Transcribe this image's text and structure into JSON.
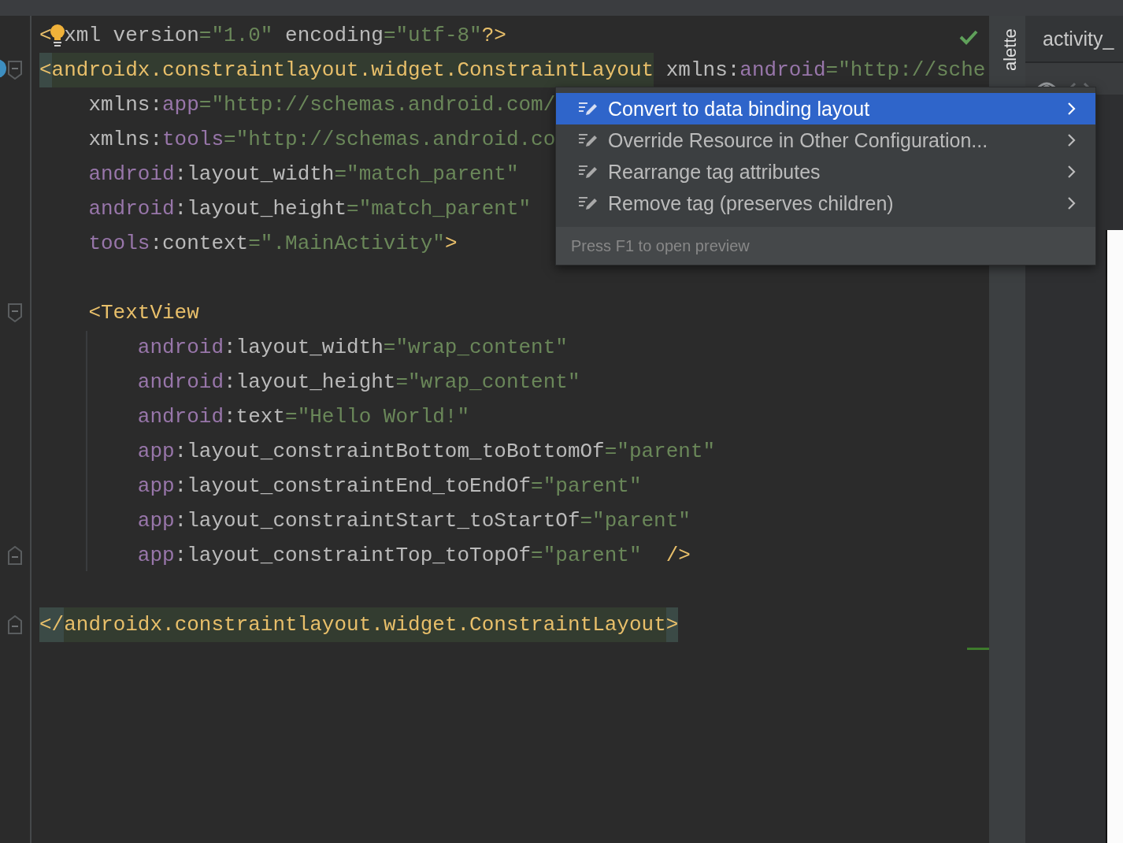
{
  "editor": {
    "lines": [
      {
        "kind": "code",
        "tokens": [
          {
            "t": "<",
            "kind": "tag"
          },
          {
            "kind": "bulb"
          },
          {
            "t": "xml version",
            "kind": "plain"
          },
          {
            "t": "=\"1.0\"",
            "kind": "value"
          },
          {
            "t": " encoding",
            "kind": "plain"
          },
          {
            "t": "=\"utf-8\"",
            "kind": "value"
          },
          {
            "t": "?>",
            "kind": "tag"
          }
        ]
      },
      {
        "kind": "code",
        "marker": {
          "kind": "fold-start"
        },
        "tokens": [
          {
            "t": "<",
            "kind": "bracem"
          },
          {
            "t": "androidx.constraintlayout.widget.ConstraintLayout",
            "kind": "tagm"
          },
          {
            "t": " xmlns:",
            "kind": "plain"
          },
          {
            "t": "android",
            "kind": "ns"
          },
          {
            "t": "=\"http://sche",
            "kind": "value"
          }
        ],
        "children": [
          {
            "kind": "code",
            "tokens": [
              {
                "t": "xmlns:",
                "kind": "plain"
              },
              {
                "t": "app",
                "kind": "ns"
              },
              {
                "t": "=\"http://schemas.android.com/",
                "kind": "value"
              }
            ]
          },
          {
            "kind": "code",
            "tokens": [
              {
                "t": "xmlns:",
                "kind": "plain"
              },
              {
                "t": "tools",
                "kind": "ns"
              },
              {
                "t": "=\"http://schemas.android.co",
                "kind": "value"
              }
            ]
          },
          {
            "kind": "code",
            "tokens": [
              {
                "t": "android",
                "kind": "ns"
              },
              {
                "t": ":layout_width",
                "kind": "plain"
              },
              {
                "t": "=\"match_parent\"",
                "kind": "value"
              }
            ]
          },
          {
            "kind": "code",
            "tokens": [
              {
                "t": "android",
                "kind": "ns"
              },
              {
                "t": ":layout_height",
                "kind": "plain"
              },
              {
                "t": "=\"match_parent\"",
                "kind": "value"
              }
            ]
          },
          {
            "kind": "code",
            "tokens": [
              {
                "t": "tools",
                "kind": "ns"
              },
              {
                "t": ":context",
                "kind": "plain"
              },
              {
                "t": "=\".MainActivity\"",
                "kind": "value"
              },
              {
                "t": ">",
                "kind": "tag"
              }
            ]
          },
          {
            "kind": "blank"
          },
          {
            "kind": "code",
            "marker": {
              "kind": "fold-start"
            },
            "tokens": [
              {
                "t": "<TextView",
                "kind": "tag"
              }
            ],
            "children": [
              {
                "kind": "code",
                "tokens": [
                  {
                    "t": "android",
                    "kind": "ns"
                  },
                  {
                    "t": ":layout_width",
                    "kind": "plain"
                  },
                  {
                    "t": "=\"wrap_content\"",
                    "kind": "value"
                  }
                ]
              },
              {
                "kind": "code",
                "tokens": [
                  {
                    "t": "android",
                    "kind": "ns"
                  },
                  {
                    "t": ":layout_height",
                    "kind": "plain"
                  },
                  {
                    "t": "=\"wrap_content\"",
                    "kind": "value"
                  }
                ]
              },
              {
                "kind": "code",
                "tokens": [
                  {
                    "t": "android",
                    "kind": "ns"
                  },
                  {
                    "t": ":text",
                    "kind": "plain"
                  },
                  {
                    "t": "=\"Hello World!\"",
                    "kind": "value"
                  }
                ]
              },
              {
                "kind": "code",
                "tokens": [
                  {
                    "t": "app",
                    "kind": "ns"
                  },
                  {
                    "t": ":layout_constraintBottom_toBottomOf",
                    "kind": "plain"
                  },
                  {
                    "t": "=\"parent\"",
                    "kind": "value"
                  }
                ]
              },
              {
                "kind": "code",
                "tokens": [
                  {
                    "t": "app",
                    "kind": "ns"
                  },
                  {
                    "t": ":layout_constraintEnd_toEndOf",
                    "kind": "plain"
                  },
                  {
                    "t": "=\"parent\"",
                    "kind": "value"
                  }
                ]
              },
              {
                "kind": "code",
                "tokens": [
                  {
                    "t": "app",
                    "kind": "ns"
                  },
                  {
                    "t": ":layout_constraintStart_toStartOf",
                    "kind": "plain"
                  },
                  {
                    "t": "=\"parent\"",
                    "kind": "value"
                  }
                ]
              },
              {
                "kind": "code",
                "marker": {
                  "kind": "fold-end"
                },
                "tokens": [
                  {
                    "t": "app",
                    "kind": "ns"
                  },
                  {
                    "t": ":layout_constraintTop_toTopOf",
                    "kind": "plain"
                  },
                  {
                    "t": "=\"parent\"",
                    "kind": "value"
                  },
                  {
                    "t": "  />",
                    "kind": "tag"
                  }
                ]
              }
            ]
          }
        ]
      },
      {
        "kind": "blank"
      },
      {
        "kind": "code",
        "marker": {
          "kind": "fold-end"
        },
        "tokens": [
          {
            "t": "</",
            "kind": "bracem"
          },
          {
            "t": "androidx.constraintlayout.widget.ConstraintLayout",
            "kind": "tagm"
          },
          {
            "t": ">",
            "kind": "bracem"
          }
        ]
      }
    ]
  },
  "popup": {
    "items": [
      {
        "label": "Convert to data binding layout",
        "selected": true
      },
      {
        "label": "Override Resource in Other Configuration...",
        "selected": false
      },
      {
        "label": "Rearrange tag attributes",
        "selected": false
      },
      {
        "label": "Remove tag (preserves children)",
        "selected": false
      }
    ],
    "hint": "Press F1 to open preview"
  },
  "palette_tab": {
    "label": "alette"
  },
  "design_panel": {
    "tab": "activity_"
  }
}
